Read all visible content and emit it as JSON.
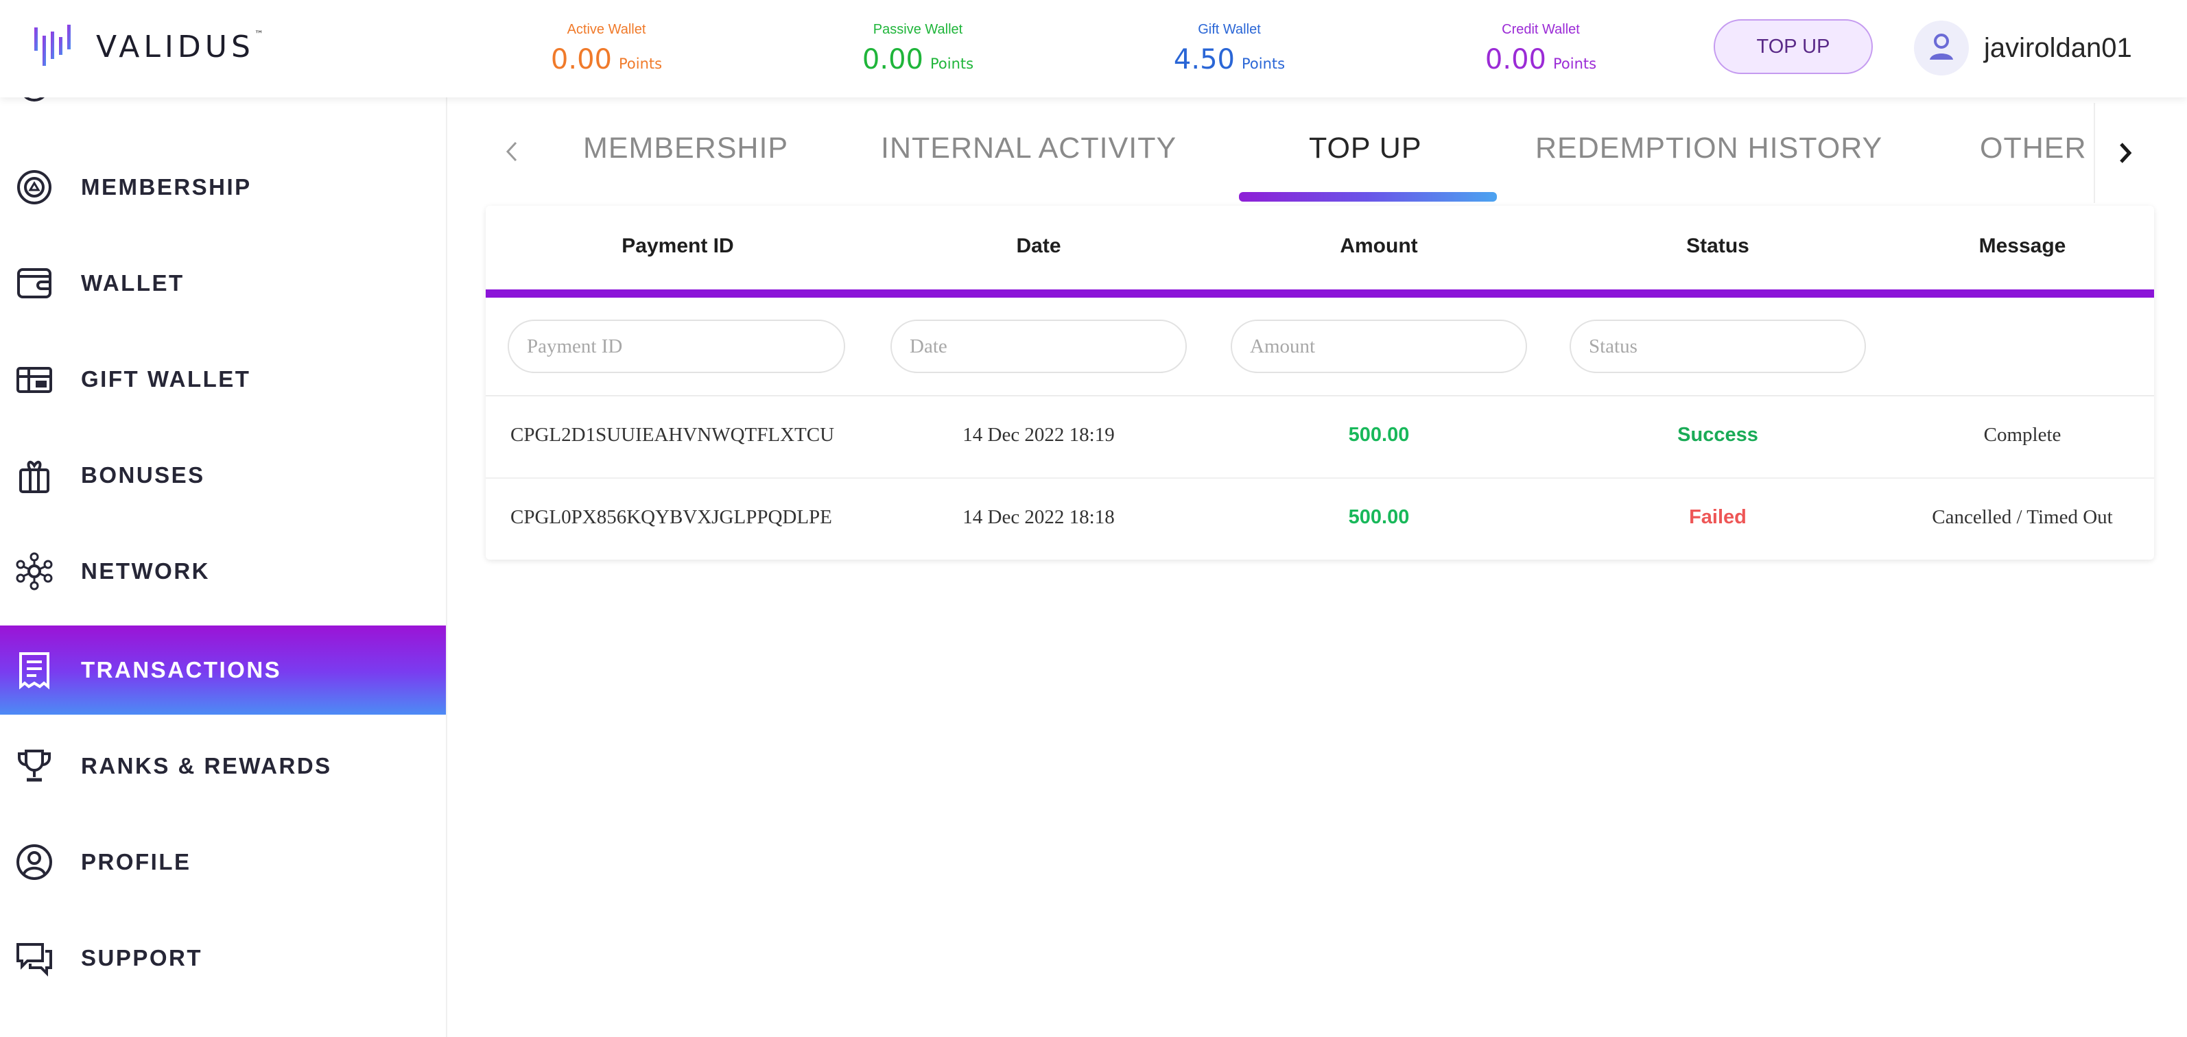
{
  "brand": {
    "name": "VALIDUS",
    "trademark": "™"
  },
  "wallets": [
    {
      "label": "Active Wallet",
      "value": "0.00",
      "unit": "Points",
      "color": "#f07a2a"
    },
    {
      "label": "Passive Wallet",
      "value": "0.00",
      "unit": "Points",
      "color": "#1fb53a"
    },
    {
      "label": "Gift Wallet",
      "value": "4.50",
      "unit": "Points",
      "color": "#2a66d6"
    },
    {
      "label": "Credit Wallet",
      "value": "0.00",
      "unit": "Points",
      "color": "#9b2bd6"
    }
  ],
  "header": {
    "topup_label": "TOP UP",
    "username": "javiroldan01"
  },
  "sidebar": {
    "items": [
      {
        "label": "MEMBERSHIP",
        "icon": "membership-icon"
      },
      {
        "label": "WALLET",
        "icon": "wallet-icon"
      },
      {
        "label": "GIFT WALLET",
        "icon": "gift-wallet-icon"
      },
      {
        "label": "BONUSES",
        "icon": "gift-box-icon"
      },
      {
        "label": "NETWORK",
        "icon": "network-icon"
      },
      {
        "label": "TRANSACTIONS",
        "icon": "receipt-icon",
        "active": true
      },
      {
        "label": "RANKS & REWARDS",
        "icon": "trophy-icon"
      },
      {
        "label": "PROFILE",
        "icon": "user-circle-icon"
      },
      {
        "label": "SUPPORT",
        "icon": "chat-support-icon"
      }
    ]
  },
  "tabs": [
    {
      "label": "MEMBERSHIP"
    },
    {
      "label": "INTERNAL ACTIVITY"
    },
    {
      "label": "TOP UP",
      "active": true
    },
    {
      "label": "REDEMPTION HISTORY"
    },
    {
      "label": "OTHER"
    }
  ],
  "table": {
    "columns": [
      "Payment ID",
      "Date",
      "Amount",
      "Status",
      "Message"
    ],
    "filters": {
      "payment_id": "Payment ID",
      "date": "Date",
      "amount": "Amount",
      "status": "Status"
    },
    "rows": [
      {
        "payment_id": "CPGL2D1SUUIEAHVNWQTFLXTCU",
        "date": "14 Dec 2022 18:19",
        "amount": "500.00",
        "status": "Success",
        "message": "Complete"
      },
      {
        "payment_id": "CPGL0PX856KQYBVXJGLPPQDLPE",
        "date": "14 Dec 2022 18:18",
        "amount": "500.00",
        "status": "Failed",
        "message": "Cancelled / Timed Out"
      }
    ]
  },
  "colors": {
    "accent_purple": "#8b14d8",
    "active_gradient_end": "#4d8bf5",
    "success": "#1aab57",
    "failed": "#ee5656",
    "amount": "#18b85a"
  }
}
